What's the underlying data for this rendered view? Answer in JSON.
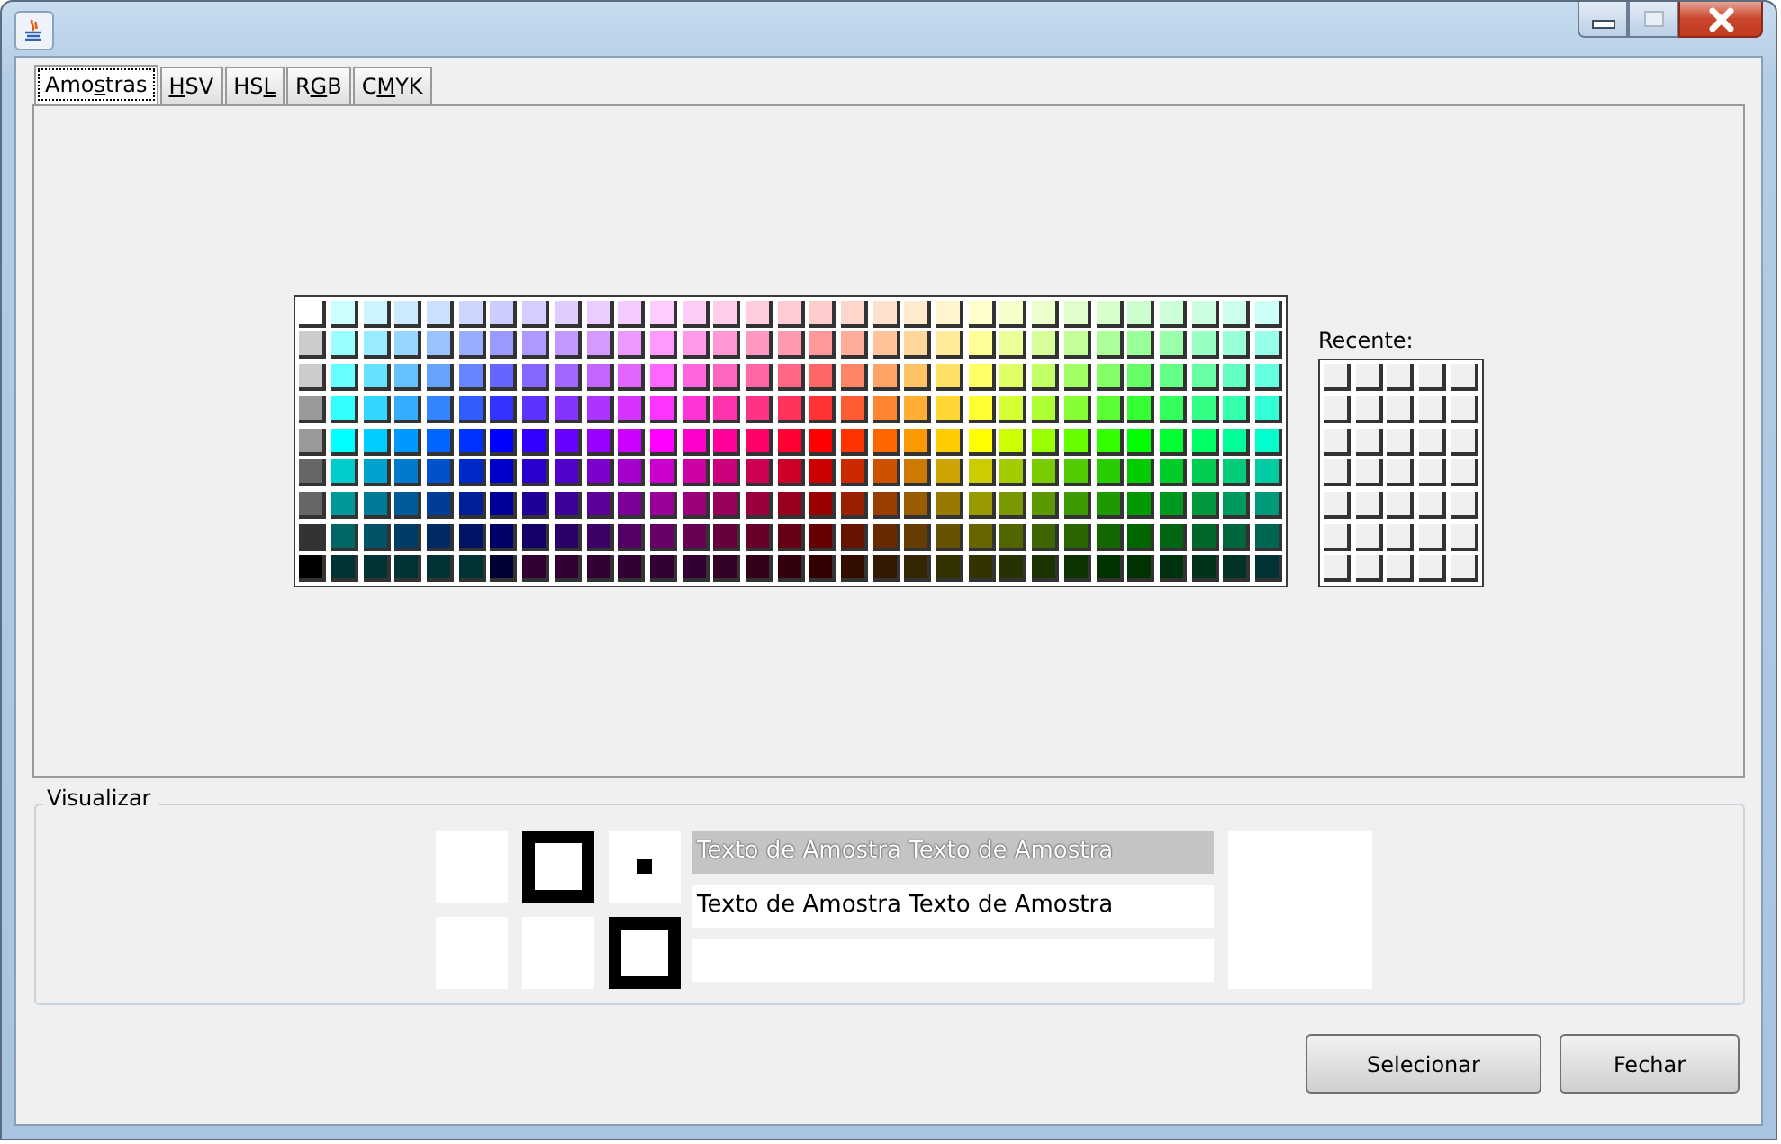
{
  "tabs": [
    {
      "before": "Amo",
      "key": "s",
      "after": "tras",
      "selected": true
    },
    {
      "key": "H",
      "after": "SV",
      "selected": false
    },
    {
      "before": "HS",
      "key": "L",
      "selected": false
    },
    {
      "before": "R",
      "key": "G",
      "after": "B",
      "selected": false
    },
    {
      "before": "C",
      "key": "M",
      "after": "YK",
      "selected": false
    }
  ],
  "swatch_rows": [
    {
      "swatches": [
        {
          "color": "#ffffff"
        },
        {
          "color": "#ccffff"
        },
        {
          "color": "#ccf5ff"
        },
        {
          "color": "#ccebff"
        },
        {
          "color": "#cce0ff"
        },
        {
          "color": "#ccd6ff"
        },
        {
          "color": "#ccccff"
        },
        {
          "color": "#d6ccff"
        },
        {
          "color": "#e0ccff"
        },
        {
          "color": "#ebccff"
        },
        {
          "color": "#f5ccff"
        },
        {
          "color": "#ffccff"
        },
        {
          "color": "#ffccf5"
        },
        {
          "color": "#ffcceb"
        },
        {
          "color": "#ffcce0"
        },
        {
          "color": "#ffccd6"
        },
        {
          "color": "#ffcccc"
        },
        {
          "color": "#ffd6cc"
        },
        {
          "color": "#ffe0cc"
        },
        {
          "color": "#ffebcc"
        },
        {
          "color": "#fff5cc"
        },
        {
          "color": "#ffffcc"
        },
        {
          "color": "#f5ffcc"
        },
        {
          "color": "#ebffcc"
        },
        {
          "color": "#e0ffcc"
        },
        {
          "color": "#d6ffcc"
        },
        {
          "color": "#ccffcc"
        },
        {
          "color": "#ccffd6"
        },
        {
          "color": "#ccffe0"
        },
        {
          "color": "#ccffeb"
        },
        {
          "color": "#ccfff5"
        }
      ]
    },
    {
      "swatches": [
        {
          "color": "#cccccc"
        },
        {
          "color": "#99ffff"
        },
        {
          "color": "#99ebff"
        },
        {
          "color": "#99d6ff"
        },
        {
          "color": "#99c2ff"
        },
        {
          "color": "#99adff"
        },
        {
          "color": "#9999ff"
        },
        {
          "color": "#ad99ff"
        },
        {
          "color": "#c299ff"
        },
        {
          "color": "#d699ff"
        },
        {
          "color": "#eb99ff"
        },
        {
          "color": "#ff99ff"
        },
        {
          "color": "#ff99eb"
        },
        {
          "color": "#ff99d6"
        },
        {
          "color": "#ff99c2"
        },
        {
          "color": "#ff99ad"
        },
        {
          "color": "#ff9999"
        },
        {
          "color": "#ffad99"
        },
        {
          "color": "#ffc299"
        },
        {
          "color": "#ffd699"
        },
        {
          "color": "#ffeb99"
        },
        {
          "color": "#ffff99"
        },
        {
          "color": "#ebff99"
        },
        {
          "color": "#d6ff99"
        },
        {
          "color": "#c2ff99"
        },
        {
          "color": "#adff99"
        },
        {
          "color": "#99ff99"
        },
        {
          "color": "#99ffad"
        },
        {
          "color": "#99ffc2"
        },
        {
          "color": "#99ffd6"
        },
        {
          "color": "#99ffeb"
        }
      ]
    },
    {
      "swatches": [
        {
          "color": "#cccccc"
        },
        {
          "color": "#66ffff"
        },
        {
          "color": "#66e0ff"
        },
        {
          "color": "#66c2ff"
        },
        {
          "color": "#66a3ff"
        },
        {
          "color": "#6685ff"
        },
        {
          "color": "#6666ff"
        },
        {
          "color": "#8566ff"
        },
        {
          "color": "#a366ff"
        },
        {
          "color": "#c266ff"
        },
        {
          "color": "#e066ff"
        },
        {
          "color": "#ff66ff"
        },
        {
          "color": "#ff66e0"
        },
        {
          "color": "#ff66c2"
        },
        {
          "color": "#ff66a3"
        },
        {
          "color": "#ff6685"
        },
        {
          "color": "#ff6666"
        },
        {
          "color": "#ff8566"
        },
        {
          "color": "#ffa366"
        },
        {
          "color": "#ffc266"
        },
        {
          "color": "#ffe066"
        },
        {
          "color": "#ffff66"
        },
        {
          "color": "#e0ff66"
        },
        {
          "color": "#c2ff66"
        },
        {
          "color": "#a3ff66"
        },
        {
          "color": "#85ff66"
        },
        {
          "color": "#66ff66"
        },
        {
          "color": "#66ff85"
        },
        {
          "color": "#66ffa3"
        },
        {
          "color": "#66ffc2"
        },
        {
          "color": "#66ffe0"
        }
      ]
    },
    {
      "swatches": [
        {
          "color": "#999999"
        },
        {
          "color": "#33ffff"
        },
        {
          "color": "#33d6ff"
        },
        {
          "color": "#33adff"
        },
        {
          "color": "#3385ff"
        },
        {
          "color": "#335cff"
        },
        {
          "color": "#3333ff"
        },
        {
          "color": "#5c33ff"
        },
        {
          "color": "#8533ff"
        },
        {
          "color": "#ad33ff"
        },
        {
          "color": "#d633ff"
        },
        {
          "color": "#ff33ff"
        },
        {
          "color": "#ff33d6"
        },
        {
          "color": "#ff33ad"
        },
        {
          "color": "#ff3385"
        },
        {
          "color": "#ff335c"
        },
        {
          "color": "#ff3333"
        },
        {
          "color": "#ff5c33"
        },
        {
          "color": "#ff8533"
        },
        {
          "color": "#ffad33"
        },
        {
          "color": "#ffd633"
        },
        {
          "color": "#ffff33"
        },
        {
          "color": "#d6ff33"
        },
        {
          "color": "#adff33"
        },
        {
          "color": "#85ff33"
        },
        {
          "color": "#5cff33"
        },
        {
          "color": "#33ff33"
        },
        {
          "color": "#33ff5c"
        },
        {
          "color": "#33ff85"
        },
        {
          "color": "#33ffad"
        },
        {
          "color": "#33ffd6"
        }
      ]
    },
    {
      "swatches": [
        {
          "color": "#999998"
        },
        {
          "color": "#00ffff"
        },
        {
          "color": "#00ccff"
        },
        {
          "color": "#0099ff"
        },
        {
          "color": "#0066ff"
        },
        {
          "color": "#0033ff"
        },
        {
          "color": "#0000ff"
        },
        {
          "color": "#3300ff"
        },
        {
          "color": "#6600ff"
        },
        {
          "color": "#9900ff"
        },
        {
          "color": "#cc00ff"
        },
        {
          "color": "#ff00ff"
        },
        {
          "color": "#ff00cc"
        },
        {
          "color": "#ff0099"
        },
        {
          "color": "#ff0066"
        },
        {
          "color": "#ff0033"
        },
        {
          "color": "#ff0000"
        },
        {
          "color": "#ff3300"
        },
        {
          "color": "#ff6600"
        },
        {
          "color": "#ff9900"
        },
        {
          "color": "#ffcc00"
        },
        {
          "color": "#ffff00"
        },
        {
          "color": "#ccff00"
        },
        {
          "color": "#99ff00"
        },
        {
          "color": "#66ff00"
        },
        {
          "color": "#33ff00"
        },
        {
          "color": "#00ff00"
        },
        {
          "color": "#00ff33"
        },
        {
          "color": "#00ff66"
        },
        {
          "color": "#00ff99"
        },
        {
          "color": "#00ffcc"
        }
      ]
    },
    {
      "swatches": [
        {
          "color": "#666666"
        },
        {
          "color": "#00cccc"
        },
        {
          "color": "#00a3cc"
        },
        {
          "color": "#007acc"
        },
        {
          "color": "#0052cc"
        },
        {
          "color": "#0029cc"
        },
        {
          "color": "#0000cc"
        },
        {
          "color": "#2900cc"
        },
        {
          "color": "#5200cc"
        },
        {
          "color": "#7a00cc"
        },
        {
          "color": "#a300cc"
        },
        {
          "color": "#cc00cc"
        },
        {
          "color": "#cc00a3"
        },
        {
          "color": "#cc007a"
        },
        {
          "color": "#cc0052"
        },
        {
          "color": "#cc0029"
        },
        {
          "color": "#cc0000"
        },
        {
          "color": "#cc2900"
        },
        {
          "color": "#cc5200"
        },
        {
          "color": "#cc7a00"
        },
        {
          "color": "#cca300"
        },
        {
          "color": "#cccc00"
        },
        {
          "color": "#a3cc00"
        },
        {
          "color": "#7acc00"
        },
        {
          "color": "#52cc00"
        },
        {
          "color": "#29cc00"
        },
        {
          "color": "#00cc00"
        },
        {
          "color": "#00cc29"
        },
        {
          "color": "#00cc52"
        },
        {
          "color": "#00cc7a"
        },
        {
          "color": "#00cca3"
        }
      ]
    },
    {
      "swatches": [
        {
          "color": "#666665"
        },
        {
          "color": "#009999"
        },
        {
          "color": "#007a99"
        },
        {
          "color": "#005c99"
        },
        {
          "color": "#003d99"
        },
        {
          "color": "#001f99"
        },
        {
          "color": "#000099"
        },
        {
          "color": "#1f0099"
        },
        {
          "color": "#3d0099"
        },
        {
          "color": "#5c0099"
        },
        {
          "color": "#7a0099"
        },
        {
          "color": "#990099"
        },
        {
          "color": "#99007a"
        },
        {
          "color": "#99005c"
        },
        {
          "color": "#99003d"
        },
        {
          "color": "#99001f"
        },
        {
          "color": "#990000"
        },
        {
          "color": "#991f00"
        },
        {
          "color": "#993d00"
        },
        {
          "color": "#995c00"
        },
        {
          "color": "#997a00"
        },
        {
          "color": "#999900"
        },
        {
          "color": "#7a9900"
        },
        {
          "color": "#5c9900"
        },
        {
          "color": "#3d9900"
        },
        {
          "color": "#1f9900"
        },
        {
          "color": "#009900"
        },
        {
          "color": "#00991f"
        },
        {
          "color": "#00993d"
        },
        {
          "color": "#00995c"
        },
        {
          "color": "#00997a"
        }
      ]
    },
    {
      "swatches": [
        {
          "color": "#333333"
        },
        {
          "color": "#006666"
        },
        {
          "color": "#005266"
        },
        {
          "color": "#003d66"
        },
        {
          "color": "#002966"
        },
        {
          "color": "#001466"
        },
        {
          "color": "#000066"
        },
        {
          "color": "#140066"
        },
        {
          "color": "#290066"
        },
        {
          "color": "#3d0066"
        },
        {
          "color": "#520066"
        },
        {
          "color": "#660066"
        },
        {
          "color": "#660052"
        },
        {
          "color": "#66003d"
        },
        {
          "color": "#660029"
        },
        {
          "color": "#660014"
        },
        {
          "color": "#660000"
        },
        {
          "color": "#661400"
        },
        {
          "color": "#662900"
        },
        {
          "color": "#663d00"
        },
        {
          "color": "#665200"
        },
        {
          "color": "#666600"
        },
        {
          "color": "#526600"
        },
        {
          "color": "#3d6600"
        },
        {
          "color": "#296600"
        },
        {
          "color": "#146600"
        },
        {
          "color": "#006600"
        },
        {
          "color": "#006614"
        },
        {
          "color": "#006629"
        },
        {
          "color": "#00663d"
        },
        {
          "color": "#006652"
        }
      ]
    },
    {
      "swatches": [
        {
          "color": "#000000"
        },
        {
          "color": "#003333"
        },
        {
          "color": "#003333"
        },
        {
          "color": "#003333"
        },
        {
          "color": "#003333"
        },
        {
          "color": "#003333"
        },
        {
          "color": "#000033"
        },
        {
          "color": "#330033"
        },
        {
          "color": "#330033"
        },
        {
          "color": "#330033"
        },
        {
          "color": "#330033"
        },
        {
          "color": "#330033"
        },
        {
          "color": "#330033"
        },
        {
          "color": "#330026"
        },
        {
          "color": "#33001a"
        },
        {
          "color": "#33000d"
        },
        {
          "color": "#330000"
        },
        {
          "color": "#330d00"
        },
        {
          "color": "#331a00"
        },
        {
          "color": "#332600"
        },
        {
          "color": "#333300"
        },
        {
          "color": "#333300"
        },
        {
          "color": "#263300"
        },
        {
          "color": "#1a3300"
        },
        {
          "color": "#0d3300"
        },
        {
          "color": "#003300"
        },
        {
          "color": "#003300"
        },
        {
          "color": "#00330d"
        },
        {
          "color": "#00331a"
        },
        {
          "color": "#003326"
        },
        {
          "color": "#003333"
        }
      ]
    }
  ],
  "recent": {
    "label": "Recente:"
  },
  "preview": {
    "title": "Visualizar",
    "color": "#ffffff",
    "sample_texts": [
      "Texto de Amostra Texto de Amostra",
      "Texto de Amostra Texto de Amostra"
    ]
  },
  "buttons": [
    "Selecionar",
    "Fechar"
  ]
}
